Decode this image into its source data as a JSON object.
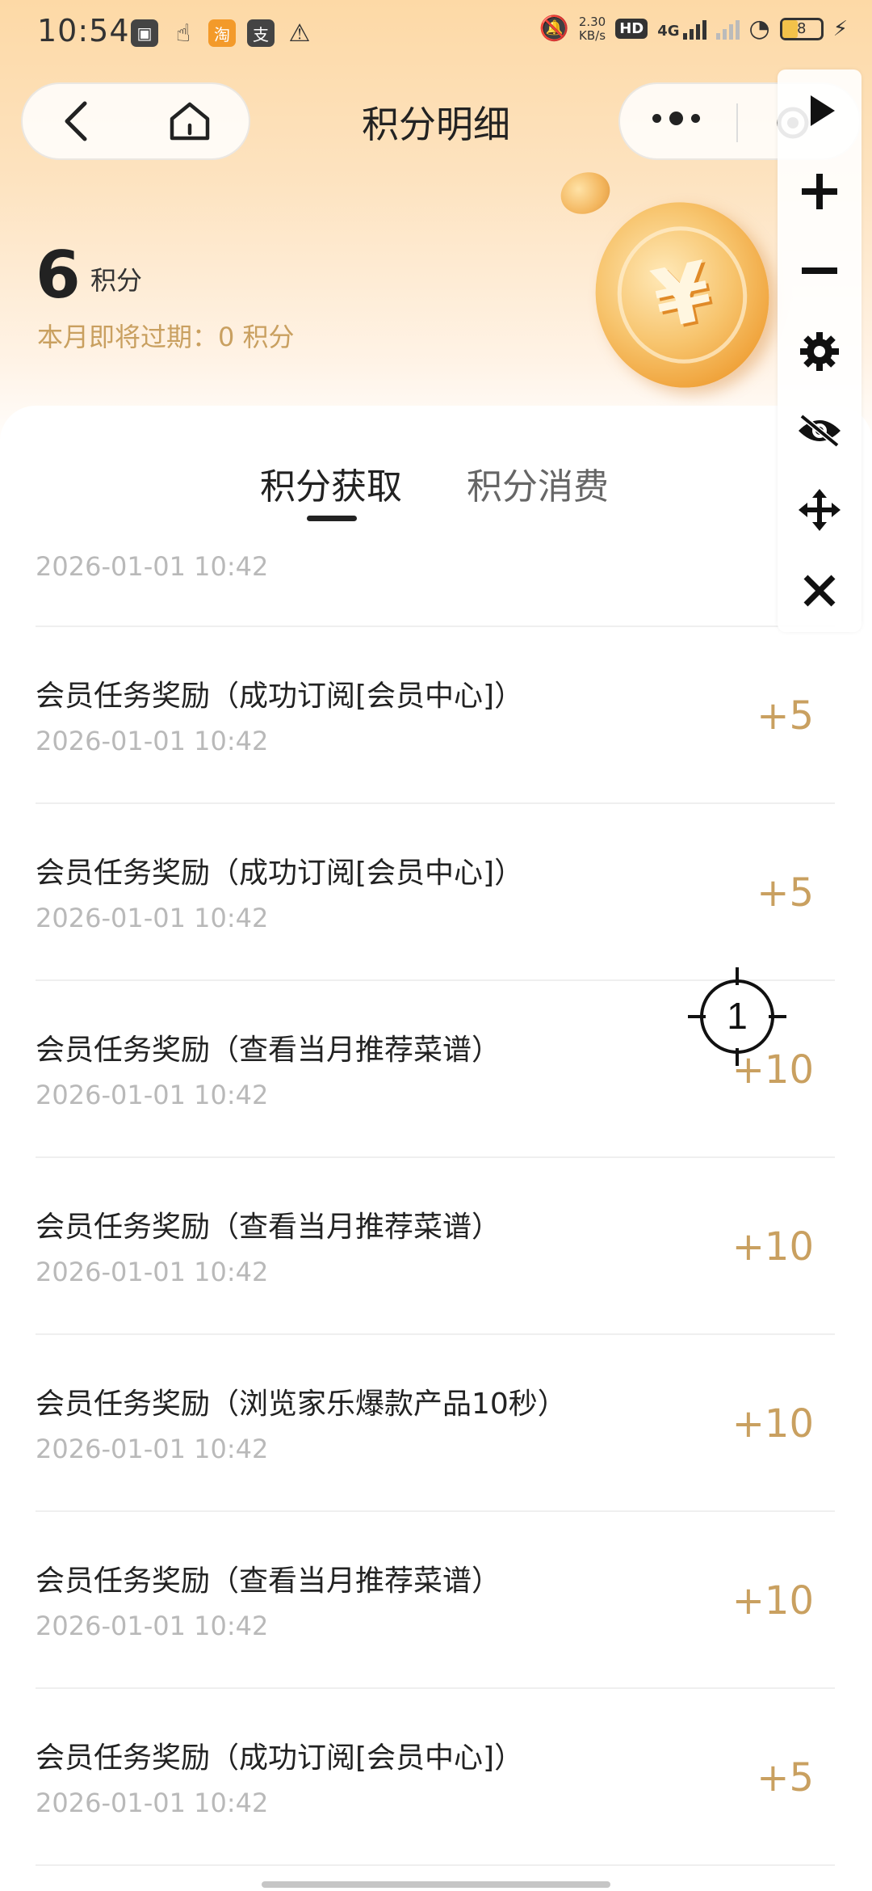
{
  "status_bar": {
    "time": "10:54",
    "net_speed_value": "2.30",
    "net_speed_unit": "KB/s",
    "hd_label": "HD",
    "network_type": "4G",
    "battery_level": "8"
  },
  "nav": {
    "title": "积分明细"
  },
  "points": {
    "value": "6",
    "unit": "积分",
    "expiring_text": "本月即将过期：0 积分"
  },
  "coin": {
    "symbol": "¥"
  },
  "tabs": [
    {
      "label": "积分获取",
      "active": true
    },
    {
      "label": "积分消费",
      "active": false
    }
  ],
  "records": [
    {
      "title": "",
      "time": "2026-01-01 10:42",
      "points": ""
    },
    {
      "title": "会员任务奖励（成功订阅[会员中心]）",
      "time": "2026-01-01 10:42",
      "points": "+5"
    },
    {
      "title": "会员任务奖励（成功订阅[会员中心]）",
      "time": "2026-01-01 10:42",
      "points": "+5"
    },
    {
      "title": "会员任务奖励（查看当月推荐菜谱）",
      "time": "2026-01-01 10:42",
      "points": "+10"
    },
    {
      "title": "会员任务奖励（查看当月推荐菜谱）",
      "time": "2026-01-01 10:42",
      "points": "+10"
    },
    {
      "title": "会员任务奖励（浏览家乐爆款产品10秒）",
      "time": "2026-01-01 10:42",
      "points": "+10"
    },
    {
      "title": "会员任务奖励（查看当月推荐菜谱）",
      "time": "2026-01-01 10:42",
      "points": "+10"
    },
    {
      "title": "会员任务奖励（成功订阅[会员中心]）",
      "time": "2026-01-01 10:42",
      "points": "+5"
    }
  ],
  "overlay": {
    "crosshair_label": "1"
  },
  "colors": {
    "accent_gold": "#c9a060",
    "header_gradient_top": "#fdd9a6"
  }
}
